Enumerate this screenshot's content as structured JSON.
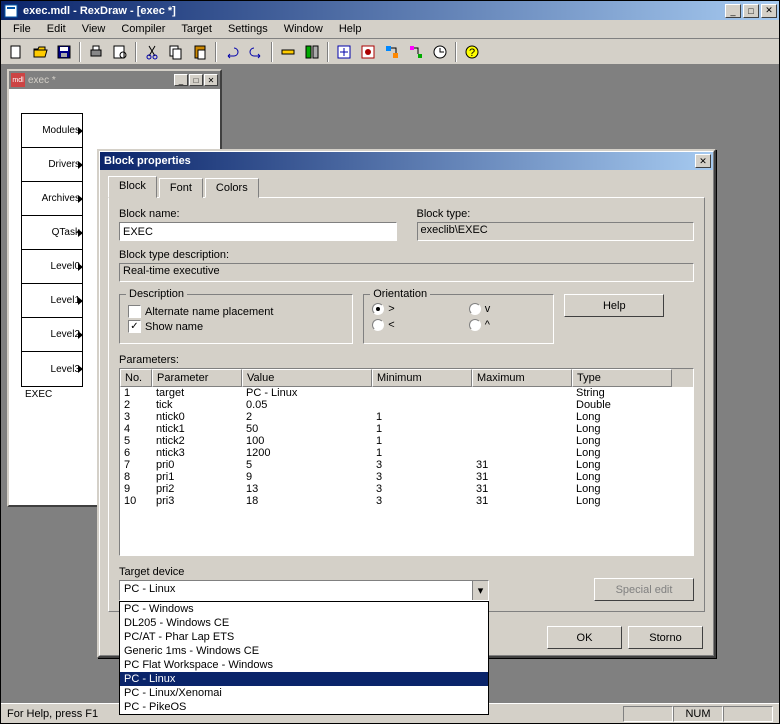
{
  "title": "exec.mdl - RexDraw - [exec *]",
  "menu": [
    "File",
    "Edit",
    "View",
    "Compiler",
    "Target",
    "Settings",
    "Window",
    "Help"
  ],
  "child_title": "exec *",
  "exec_cells": [
    "Modules",
    "Drivers",
    "Archives",
    "QTask",
    "Level0",
    "Level1",
    "Level2",
    "Level3"
  ],
  "exec_label": "EXEC",
  "dialog": {
    "title": "Block properties",
    "tabs": [
      "Block",
      "Font",
      "Colors"
    ],
    "block_name_label": "Block name:",
    "block_name": "EXEC",
    "block_type_label": "Block type:",
    "block_type": "execlib\\EXEC",
    "block_type_desc_label": "Block type description:",
    "block_type_desc": "Real-time executive",
    "description_group": "Description",
    "alt_name_label": "Alternate name placement",
    "show_name_label": "Show name",
    "orientation_group": "Orientation",
    "help_label": "Help",
    "parameters_label": "Parameters:",
    "param_headers": [
      "No.",
      "Parameter",
      "Value",
      "Minimum",
      "Maximum",
      "Type"
    ],
    "params": [
      {
        "no": "1",
        "p": "target",
        "v": "PC - Linux",
        "min": "",
        "max": "",
        "t": "String"
      },
      {
        "no": "2",
        "p": "tick",
        "v": "0.05",
        "min": "",
        "max": "",
        "t": "Double"
      },
      {
        "no": "3",
        "p": "ntick0",
        "v": "2",
        "min": "1",
        "max": "",
        "t": "Long"
      },
      {
        "no": "4",
        "p": "ntick1",
        "v": "50",
        "min": "1",
        "max": "",
        "t": "Long"
      },
      {
        "no": "5",
        "p": "ntick2",
        "v": "100",
        "min": "1",
        "max": "",
        "t": "Long"
      },
      {
        "no": "6",
        "p": "ntick3",
        "v": "1200",
        "min": "1",
        "max": "",
        "t": "Long"
      },
      {
        "no": "7",
        "p": "pri0",
        "v": "5",
        "min": "3",
        "max": "31",
        "t": "Long"
      },
      {
        "no": "8",
        "p": "pri1",
        "v": "9",
        "min": "3",
        "max": "31",
        "t": "Long"
      },
      {
        "no": "9",
        "p": "pri2",
        "v": "13",
        "min": "3",
        "max": "31",
        "t": "Long"
      },
      {
        "no": "10",
        "p": "pri3",
        "v": "18",
        "min": "3",
        "max": "31",
        "t": "Long"
      }
    ],
    "target_device_label": "Target device",
    "target_device": "PC - Linux",
    "target_options": [
      "PC - Windows",
      "DL205 - Windows CE",
      "PC/AT - Phar Lap ETS",
      "Generic 1ms - Windows CE",
      "PC Flat Workspace - Windows",
      "PC - Linux",
      "PC - Linux/Xenomai",
      "PC - PikeOS"
    ],
    "special_edit_label": "Special edit",
    "ok_label": "OK",
    "cancel_label": "Storno"
  },
  "status_left": "For Help, press F1",
  "status_right": "NUM"
}
